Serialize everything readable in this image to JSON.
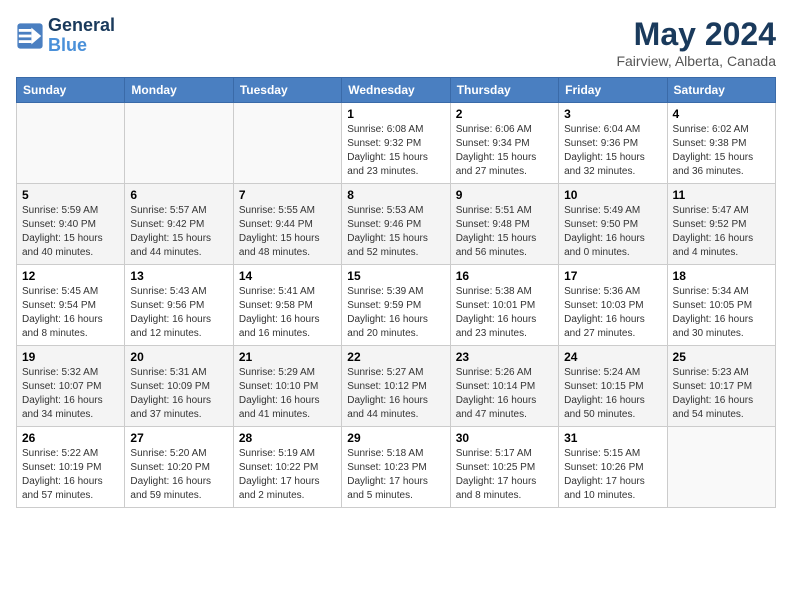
{
  "header": {
    "logo_line1": "General",
    "logo_line2": "Blue",
    "month": "May 2024",
    "location": "Fairview, Alberta, Canada"
  },
  "weekdays": [
    "Sunday",
    "Monday",
    "Tuesday",
    "Wednesday",
    "Thursday",
    "Friday",
    "Saturday"
  ],
  "weeks": [
    [
      {
        "day": "",
        "detail": ""
      },
      {
        "day": "",
        "detail": ""
      },
      {
        "day": "",
        "detail": ""
      },
      {
        "day": "1",
        "detail": "Sunrise: 6:08 AM\nSunset: 9:32 PM\nDaylight: 15 hours\nand 23 minutes."
      },
      {
        "day": "2",
        "detail": "Sunrise: 6:06 AM\nSunset: 9:34 PM\nDaylight: 15 hours\nand 27 minutes."
      },
      {
        "day": "3",
        "detail": "Sunrise: 6:04 AM\nSunset: 9:36 PM\nDaylight: 15 hours\nand 32 minutes."
      },
      {
        "day": "4",
        "detail": "Sunrise: 6:02 AM\nSunset: 9:38 PM\nDaylight: 15 hours\nand 36 minutes."
      }
    ],
    [
      {
        "day": "5",
        "detail": "Sunrise: 5:59 AM\nSunset: 9:40 PM\nDaylight: 15 hours\nand 40 minutes."
      },
      {
        "day": "6",
        "detail": "Sunrise: 5:57 AM\nSunset: 9:42 PM\nDaylight: 15 hours\nand 44 minutes."
      },
      {
        "day": "7",
        "detail": "Sunrise: 5:55 AM\nSunset: 9:44 PM\nDaylight: 15 hours\nand 48 minutes."
      },
      {
        "day": "8",
        "detail": "Sunrise: 5:53 AM\nSunset: 9:46 PM\nDaylight: 15 hours\nand 52 minutes."
      },
      {
        "day": "9",
        "detail": "Sunrise: 5:51 AM\nSunset: 9:48 PM\nDaylight: 15 hours\nand 56 minutes."
      },
      {
        "day": "10",
        "detail": "Sunrise: 5:49 AM\nSunset: 9:50 PM\nDaylight: 16 hours\nand 0 minutes."
      },
      {
        "day": "11",
        "detail": "Sunrise: 5:47 AM\nSunset: 9:52 PM\nDaylight: 16 hours\nand 4 minutes."
      }
    ],
    [
      {
        "day": "12",
        "detail": "Sunrise: 5:45 AM\nSunset: 9:54 PM\nDaylight: 16 hours\nand 8 minutes."
      },
      {
        "day": "13",
        "detail": "Sunrise: 5:43 AM\nSunset: 9:56 PM\nDaylight: 16 hours\nand 12 minutes."
      },
      {
        "day": "14",
        "detail": "Sunrise: 5:41 AM\nSunset: 9:58 PM\nDaylight: 16 hours\nand 16 minutes."
      },
      {
        "day": "15",
        "detail": "Sunrise: 5:39 AM\nSunset: 9:59 PM\nDaylight: 16 hours\nand 20 minutes."
      },
      {
        "day": "16",
        "detail": "Sunrise: 5:38 AM\nSunset: 10:01 PM\nDaylight: 16 hours\nand 23 minutes."
      },
      {
        "day": "17",
        "detail": "Sunrise: 5:36 AM\nSunset: 10:03 PM\nDaylight: 16 hours\nand 27 minutes."
      },
      {
        "day": "18",
        "detail": "Sunrise: 5:34 AM\nSunset: 10:05 PM\nDaylight: 16 hours\nand 30 minutes."
      }
    ],
    [
      {
        "day": "19",
        "detail": "Sunrise: 5:32 AM\nSunset: 10:07 PM\nDaylight: 16 hours\nand 34 minutes."
      },
      {
        "day": "20",
        "detail": "Sunrise: 5:31 AM\nSunset: 10:09 PM\nDaylight: 16 hours\nand 37 minutes."
      },
      {
        "day": "21",
        "detail": "Sunrise: 5:29 AM\nSunset: 10:10 PM\nDaylight: 16 hours\nand 41 minutes."
      },
      {
        "day": "22",
        "detail": "Sunrise: 5:27 AM\nSunset: 10:12 PM\nDaylight: 16 hours\nand 44 minutes."
      },
      {
        "day": "23",
        "detail": "Sunrise: 5:26 AM\nSunset: 10:14 PM\nDaylight: 16 hours\nand 47 minutes."
      },
      {
        "day": "24",
        "detail": "Sunrise: 5:24 AM\nSunset: 10:15 PM\nDaylight: 16 hours\nand 50 minutes."
      },
      {
        "day": "25",
        "detail": "Sunrise: 5:23 AM\nSunset: 10:17 PM\nDaylight: 16 hours\nand 54 minutes."
      }
    ],
    [
      {
        "day": "26",
        "detail": "Sunrise: 5:22 AM\nSunset: 10:19 PM\nDaylight: 16 hours\nand 57 minutes."
      },
      {
        "day": "27",
        "detail": "Sunrise: 5:20 AM\nSunset: 10:20 PM\nDaylight: 16 hours\nand 59 minutes."
      },
      {
        "day": "28",
        "detail": "Sunrise: 5:19 AM\nSunset: 10:22 PM\nDaylight: 17 hours\nand 2 minutes."
      },
      {
        "day": "29",
        "detail": "Sunrise: 5:18 AM\nSunset: 10:23 PM\nDaylight: 17 hours\nand 5 minutes."
      },
      {
        "day": "30",
        "detail": "Sunrise: 5:17 AM\nSunset: 10:25 PM\nDaylight: 17 hours\nand 8 minutes."
      },
      {
        "day": "31",
        "detail": "Sunrise: 5:15 AM\nSunset: 10:26 PM\nDaylight: 17 hours\nand 10 minutes."
      },
      {
        "day": "",
        "detail": ""
      }
    ]
  ]
}
